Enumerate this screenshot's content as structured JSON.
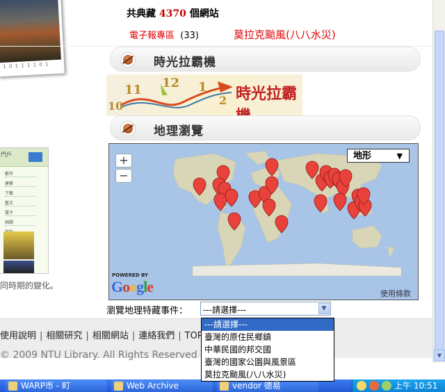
{
  "header": {
    "total_prefix": "共典藏",
    "total_count": "4370",
    "total_suffix": "個網站",
    "enews_label": "電子報專區",
    "enews_count": "(33)",
    "featured_link": "莫拉克颱風(八八水災)"
  },
  "sections": {
    "time_machine": "時光拉霸機",
    "geo_browse": "地理瀏覽"
  },
  "banner": {
    "numbers": [
      "11",
      "12",
      "1",
      "10",
      "2"
    ],
    "title": "時光拉霸機"
  },
  "photo": {
    "caption": "1 0 1 1 1 1 0 1"
  },
  "left_note": "同時期的變化。",
  "thumb": {
    "header": "門戶",
    "menu": [
      "都市",
      "建築",
      "下載",
      "藝文",
      "電子",
      "相關",
      "學院",
      "資源"
    ]
  },
  "map": {
    "zoom_in": "+",
    "zoom_out": "−",
    "map_type": "地形",
    "map_type_caret": "▼",
    "powered_by": "POWERED BY",
    "google": "Google",
    "terms": "使用條款",
    "colors": {
      "ocean": "#a8c4e6",
      "land": "#d9d6b8",
      "marker": "#e8423a"
    }
  },
  "filter": {
    "label": "瀏覽地理特藏事件：",
    "selected": "---請選擇---",
    "caret": "▼",
    "options": [
      "---請選擇---",
      "臺灣的原住民鄉鎮",
      "中華民國的邦交國",
      "臺灣的國家公園與風景區",
      "莫拉克颱風(八八水災)"
    ]
  },
  "footer": {
    "links": [
      "使用說明",
      "相關研究",
      "相關網站",
      "連絡我們",
      "TOP"
    ],
    "separator": "|",
    "copyright": "© 2009 NTU Library. All Rights Reserved"
  },
  "scrollbar": {
    "down_arrow": "▼"
  },
  "taskbar": {
    "items": [
      "WARP市 - 町",
      "Web Archive",
      "vendor 德易"
    ],
    "clock": "上午 10:51"
  }
}
